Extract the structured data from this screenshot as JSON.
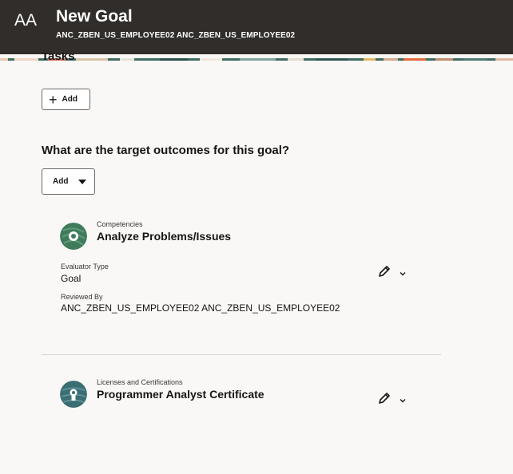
{
  "header": {
    "avatar_initials": "AA",
    "title": "New Goal",
    "subtitle": "ANC_ZBEN_US_EMPLOYEE02 ANC_ZBEN_US_EMPLOYEE02",
    "background": "#312d2a"
  },
  "tasks": {
    "heading": "Tasks",
    "add_label": "Add",
    "add_icon": "plus-icon"
  },
  "outcomes": {
    "question": "What are the target outcomes for this goal?",
    "add_label": "Add",
    "add_icon": "caret-down-icon",
    "items": [
      {
        "category": "Competencies",
        "title": "Analyze Problems/Issues",
        "icon": "competency-icon",
        "icon_color": "#3f7a5c",
        "fields": [
          {
            "label": "Evaluator Type",
            "value": "Goal"
          },
          {
            "label": "Reviewed By",
            "value": "ANC_ZBEN_US_EMPLOYEE02 ANC_ZBEN_US_EMPLOYEE02"
          }
        ],
        "actions": [
          "edit-icon",
          "chevron-down-icon"
        ]
      },
      {
        "category": "Licenses and Certifications",
        "title": "Programmer Analyst Certificate",
        "icon": "certificate-icon",
        "icon_color": "#3b6e73",
        "actions": [
          "edit-icon",
          "chevron-down-icon"
        ]
      }
    ]
  }
}
